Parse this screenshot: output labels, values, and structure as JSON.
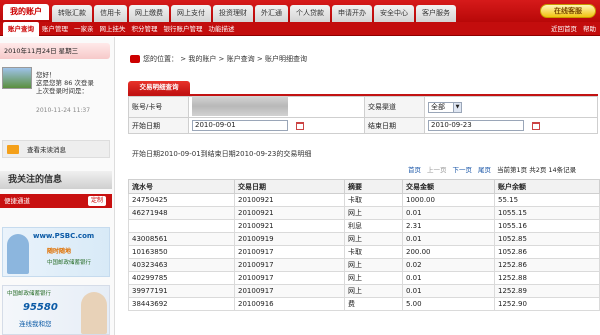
{
  "nav": {
    "brand": "我的账户",
    "tabs": [
      "转账汇款",
      "信用卡",
      "网上缴费",
      "网上支付",
      "投资理财",
      "外汇通",
      "个人贷款",
      "申请开办",
      "安全中心",
      "客户服务"
    ],
    "online_service": "在线客服"
  },
  "subnav": {
    "items": [
      "账户查询",
      "账户管理",
      "一家亲",
      "网上挂失",
      "积分管理",
      "银行账户管理",
      "功能描述"
    ],
    "right": [
      "近回首页",
      "帮助"
    ]
  },
  "side": {
    "date": "2010年11月24日 星期三",
    "greeting": "您好！",
    "login_count": "这是您第 86 次登录",
    "last_login_label": "上次登录时间是：",
    "last_login_time": "2010-11-24 11:37",
    "messages": "查看未读消息",
    "focus_title": "我关注的信息",
    "quick_link": "便捷通道",
    "custom": "定制",
    "ad1": {
      "logo": "www.PSBC.com",
      "line2": "随时随地",
      "line3": "中国邮政储蓄银行"
    },
    "ad2": {
      "bank": "中国邮政储蓄银行",
      "number": "95580",
      "slogan": "连线我和您"
    }
  },
  "main": {
    "breadcrumb": "您的位置：  >  我的账户  >  账户查询  >  账户明细查询",
    "query_tab": "交易明细查询",
    "form": {
      "account_label": "账号/卡号",
      "channel_label": "交易渠道",
      "channel_value": "全部",
      "start_label": "开始日期",
      "start_value": "2010-09-01",
      "end_label": "结束日期",
      "end_value": "2010-09-23"
    },
    "summary": "开始日期2010-09-01到结束日期2010-09-23的交易明细",
    "pager": {
      "first": "首页",
      "prev": "上一页",
      "next": "下一页",
      "last": "尾页",
      "info": "当前第1页 共2页 14条记录"
    },
    "columns": [
      "流水号",
      "交易日期",
      "摘要",
      "交易金额",
      "账户余额"
    ],
    "rows": [
      [
        "24750425",
        "20100921",
        "卡取",
        "1000.00",
        "55.15"
      ],
      [
        "46271948",
        "20100921",
        "网上",
        "0.01",
        "1055.15"
      ],
      [
        "",
        "20100921",
        "利息",
        "2.31",
        "1055.16"
      ],
      [
        "43008561",
        "20100919",
        "网上",
        "0.01",
        "1052.85"
      ],
      [
        "10163850",
        "20100917",
        "卡取",
        "200.00",
        "1052.86"
      ],
      [
        "40323463",
        "20100917",
        "网上",
        "0.02",
        "1252.86"
      ],
      [
        "40299785",
        "20100917",
        "网上",
        "0.01",
        "1252.88"
      ],
      [
        "39977191",
        "20100917",
        "网上",
        "0.01",
        "1252.89"
      ],
      [
        "38443692",
        "20100916",
        "费",
        "5.00",
        "1252.90"
      ]
    ]
  }
}
